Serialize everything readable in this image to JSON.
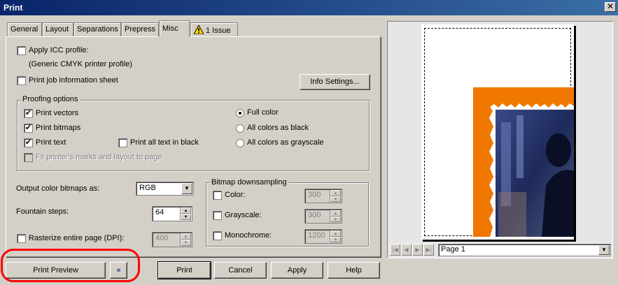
{
  "window": {
    "title": "Print",
    "close_symbol": "✕"
  },
  "tabs": [
    {
      "label": "General"
    },
    {
      "label": "Layout"
    },
    {
      "label": "Separations"
    },
    {
      "label": "Prepress"
    },
    {
      "label": "Misc",
      "active": true
    },
    {
      "label": "1 Issue",
      "icon": "warning-icon"
    }
  ],
  "misc": {
    "apply_icc_label": "Apply ICC profile:",
    "icc_profile_name": "(Generic CMYK printer profile)",
    "print_job_info_label": "Print job information sheet",
    "info_settings_button": "Info Settings...",
    "proofing": {
      "title": "Proofing options",
      "print_vectors": "Print vectors",
      "print_bitmaps": "Print bitmaps",
      "print_text": "Print text",
      "print_all_text_black": "Print all text in black",
      "fit_marks": "Fit printer's marks and layout to page",
      "full_color": "Full color",
      "all_black": "All colors as black",
      "all_grayscale": "All colors as grayscale",
      "check_mark": "✔"
    },
    "output_bitmaps_label": "Output color bitmaps as:",
    "output_bitmaps_value": "RGB",
    "fountain_steps_label": "Fountain steps:",
    "fountain_steps_value": "64",
    "rasterize_label": "Rasterize entire page (DPI):",
    "rasterize_value": "400",
    "downsampling": {
      "title": "Bitmap downsampling",
      "color_label": "Color:",
      "color_value": "300",
      "grayscale_label": "Grayscale:",
      "grayscale_value": "300",
      "monochrome_label": "Monochrome:",
      "monochrome_value": "1200"
    }
  },
  "preview": {
    "page_select_value": "Page 1",
    "colors": {
      "orange_band": "#f07800",
      "photo_dark": "#1e2a5a"
    }
  },
  "buttons": {
    "print_preview": "Print Preview",
    "collapse_icon": "«",
    "print": "Print",
    "cancel": "Cancel",
    "apply": "Apply",
    "help": "Help"
  }
}
